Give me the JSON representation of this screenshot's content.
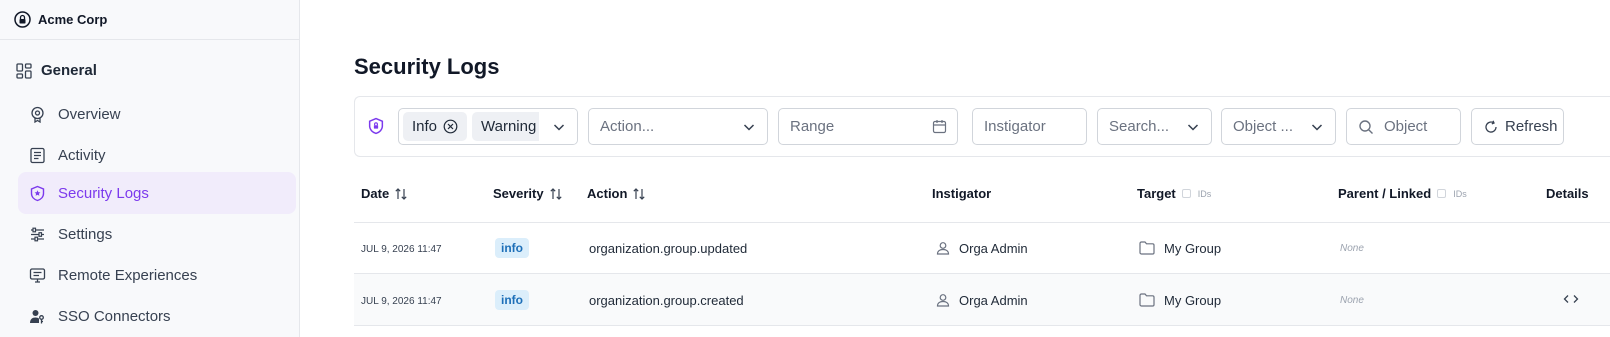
{
  "sidebar": {
    "org_name": "Acme Corp",
    "section_label": "General",
    "items": [
      {
        "label": "Overview",
        "icon": "badge-icon"
      },
      {
        "label": "Activity",
        "icon": "document-icon"
      },
      {
        "label": "Security Logs",
        "icon": "shield-icon",
        "active": true
      },
      {
        "label": "Settings",
        "icon": "sliders-icon"
      },
      {
        "label": "Remote Experiences",
        "icon": "monitor-icon"
      },
      {
        "label": "SSO Connectors",
        "icon": "user-key-icon"
      }
    ]
  },
  "main": {
    "title": "Security Logs",
    "filters": {
      "severity_chips": [
        "Info",
        "Warning"
      ],
      "action_placeholder": "Action...",
      "range_placeholder": "Range",
      "instigator_placeholder": "Instigator",
      "search_placeholder": "Search...",
      "object_type_placeholder": "Object ...",
      "object_placeholder": "Object",
      "refresh_label": "Refresh"
    },
    "table": {
      "columns": {
        "date": "Date",
        "severity": "Severity",
        "action": "Action",
        "instigator": "Instigator",
        "target": "Target",
        "parent": "Parent / Linked",
        "ids": "IDs",
        "details": "Details"
      },
      "rows": [
        {
          "date": "JUL 9, 2026 11:47",
          "severity": "info",
          "action": "organization.group.updated",
          "instigator": "Orga Admin",
          "target": "My Group",
          "parent": "None"
        },
        {
          "date": "JUL 9, 2026 11:47",
          "severity": "info",
          "action": "organization.group.created",
          "instigator": "Orga Admin",
          "target": "My Group",
          "parent": "None"
        }
      ]
    }
  },
  "colors": {
    "accent": "#7c3aed",
    "active_bg": "#f1ecfb",
    "badge_bg": "#dbeefb",
    "badge_text": "#1d6fb8"
  }
}
